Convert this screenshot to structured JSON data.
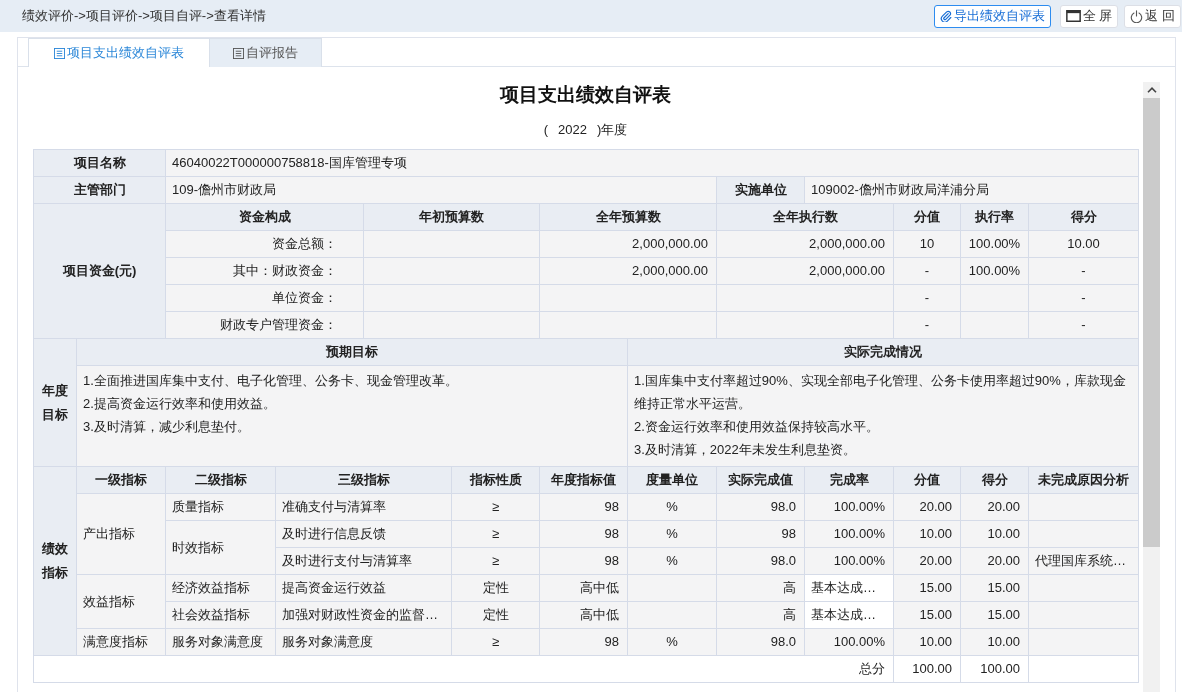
{
  "breadcrumb": "绩效评价->项目评价->项目自评->查看详情",
  "toolbar": [
    {
      "kind": "export",
      "label": "导出绩效自评表"
    },
    {
      "kind": "fullscreen",
      "label": "全 屏"
    },
    {
      "kind": "back",
      "label": "返 回"
    }
  ],
  "tabs": [
    {
      "label": "项目支出绩效自评表",
      "selected": true
    },
    {
      "label": "自评报告",
      "selected": false
    }
  ],
  "form": {
    "title": "项目支出绩效自评表",
    "year_line": {
      "prefix": "(",
      "year": "2022",
      "suffix": ")年度"
    },
    "project_name": {
      "label": "项目名称",
      "value": "46040022T000000758818-国库管理专项"
    },
    "department": {
      "label": "主管部门",
      "value": "109-儋州市财政局"
    },
    "implementer": {
      "label": "实施单位",
      "value": "109002-儋州市财政局洋浦分局"
    },
    "funds": {
      "label": "项目资金(元)",
      "columns": [
        "资金构成",
        "年初预算数",
        "全年预算数",
        "全年执行数",
        "分值",
        "执行率",
        "得分"
      ],
      "rows": [
        {
          "source": "资金总额：",
          "annual_budget": "2,000,000.00",
          "executed": "2,000,000.00",
          "score_value": "10",
          "execution_rate": "100.00%",
          "score": "10.00"
        },
        {
          "source": "其中：财政资金：",
          "annual_budget": "2,000,000.00",
          "executed": "2,000,000.00",
          "score_value": "-",
          "execution_rate": "100.00%",
          "score": "-"
        },
        {
          "source": "单位资金：",
          "score_value": "-",
          "score": "-"
        },
        {
          "source": "财政专户管理资金：",
          "score_value": "-",
          "score": "-"
        }
      ]
    },
    "annual_goals": {
      "label": "年度目标",
      "expected_heading": "预期目标",
      "actual_heading": "实际完成情况",
      "expected": [
        "1.全面推进国库集中支付、电子化管理、公务卡、现金管理改革。",
        "2.提高资金运行效率和使用效益。",
        "3.及时清算，减少利息垫付。"
      ],
      "actual": [
        "1.国库集中支付率超过90%、实现全部电子化管理、公务卡使用率超过90%，库款现金维持正常水平运营。",
        "2.资金运行效率和使用效益保持较高水平。",
        "3.及时清算，2022年未发生利息垫资。"
      ]
    },
    "indicators": {
      "label": "绩效指标",
      "columns": [
        "一级指标",
        "二级指标",
        "三级指标",
        "指标性质",
        "年度指标值",
        "度量单位",
        "实际完成值",
        "完成率",
        "分值",
        "得分",
        "未完成原因分析"
      ],
      "groups": [
        {
          "level1": "产出指标",
          "children": [
            {
              "level2": "质量指标",
              "children": [
                {
                  "kind": "quantitative",
                  "level3": "准确支付与清算率",
                  "nature": "≥",
                  "target": "98",
                  "unit": "%",
                  "actual": "98.0",
                  "rate": "100.00%",
                  "score_value": "20.00",
                  "score": "20.00"
                }
              ]
            },
            {
              "level2": "时效指标",
              "children": [
                {
                  "kind": "quantitative",
                  "level3": "及时进行信息反馈",
                  "nature": "≥",
                  "target": "98",
                  "unit": "%",
                  "actual": "98",
                  "rate": "100.00%",
                  "score_value": "10.00",
                  "score": "10.00"
                },
                {
                  "kind": "quantitative",
                  "level3": "及时进行支付与清算率",
                  "nature": "≥",
                  "target": "98",
                  "unit": "%",
                  "actual": "98.0",
                  "rate": "100.00%",
                  "score_value": "20.00",
                  "score": "20.00",
                  "reason": "代理国库系统…"
                }
              ]
            }
          ]
        },
        {
          "level1": "效益指标",
          "children": [
            {
              "level2": "经济效益指标",
              "children": [
                {
                  "kind": "qualitative",
                  "level3": "提高资金运行效益",
                  "nature": "定性",
                  "target": "高中低",
                  "actual": "高",
                  "rate": "基本达成…",
                  "score_value": "15.00",
                  "score": "15.00"
                }
              ]
            },
            {
              "level2": "社会效益指标",
              "children": [
                {
                  "kind": "qualitative",
                  "level3": "加强对财政性资金的监督…",
                  "nature": "定性",
                  "target": "高中低",
                  "actual": "高",
                  "rate": "基本达成…",
                  "score_value": "15.00",
                  "score": "15.00"
                }
              ]
            }
          ]
        },
        {
          "level1": "满意度指标",
          "children": [
            {
              "level2": "服务对象满意度",
              "children": [
                {
                  "kind": "quantitative",
                  "level3": "服务对象满意度",
                  "nature": "≥",
                  "target": "98",
                  "unit": "%",
                  "actual": "98.0",
                  "rate": "100.00%",
                  "score_value": "10.00",
                  "score": "10.00"
                }
              ]
            }
          ]
        }
      ]
    },
    "total": {
      "label": "总分",
      "score_value": "100.00",
      "score": "100.00"
    }
  }
}
